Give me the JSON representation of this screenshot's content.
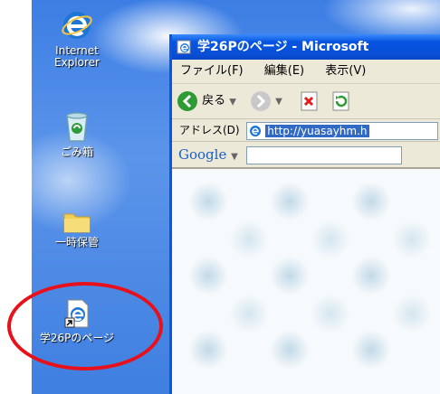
{
  "desktop": {
    "icons": [
      {
        "label_line1": "Internet",
        "label_line2": "Explorer"
      },
      {
        "label": "ごみ箱"
      },
      {
        "label": "一時保管"
      },
      {
        "label": "学26Pのページ"
      }
    ]
  },
  "window": {
    "title": "学26Pのページ - Microsoft",
    "menu": [
      "ファイル(F)",
      "編集(E)",
      "表示(V)"
    ],
    "toolbar": {
      "back_label": "戻る"
    },
    "address": {
      "label": "アドレス(D)",
      "url": "http://yuasayhm.h"
    },
    "google": {
      "brand": "Google"
    }
  },
  "colors": {
    "highlight_ring": "#e8101a",
    "title_bar": "#0a4fd6"
  }
}
